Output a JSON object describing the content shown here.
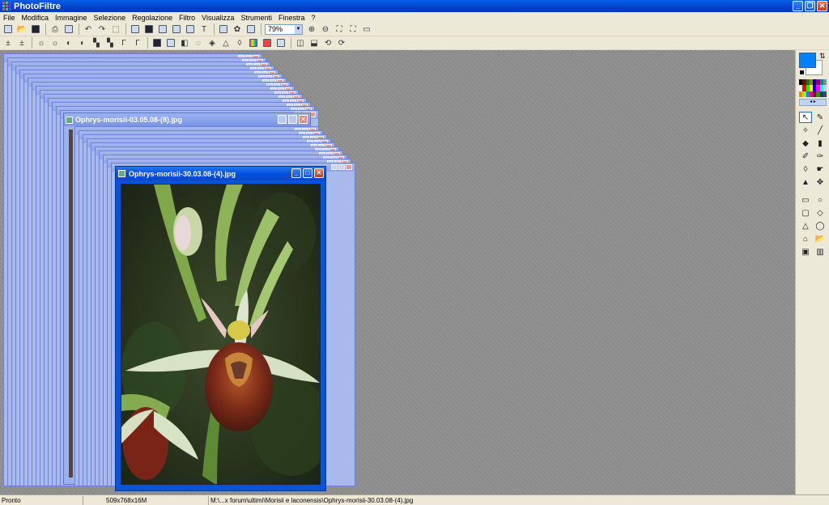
{
  "app": {
    "title": "PhotoFiltre"
  },
  "menu": [
    "File",
    "Modifica",
    "Immagine",
    "Selezione",
    "Regolazione",
    "Filtro",
    "Visualizza",
    "Strumenti",
    "Finestra",
    "?"
  ],
  "toolbar": {
    "zoom_value": "79%"
  },
  "windows": {
    "middle_title": "Ophrys-morisii-03.05.08-(8).jpg",
    "active_title": "Ophrys-morisii-30.03.08-(4).jpg"
  },
  "palette": {
    "foreground": "#0080ff",
    "background": "#ffffff"
  },
  "status": {
    "state": "Pronto",
    "dimensions": "509x768x16M",
    "path": "M:\\...x forum\\ultimi\\Morisii e laconensis\\Ophrys-morisii-30.03.08-(4).jpg"
  },
  "colors": {
    "titlebar": "#0050dc",
    "workspace": "#8f8f8f",
    "chrome": "#ece9d8"
  }
}
